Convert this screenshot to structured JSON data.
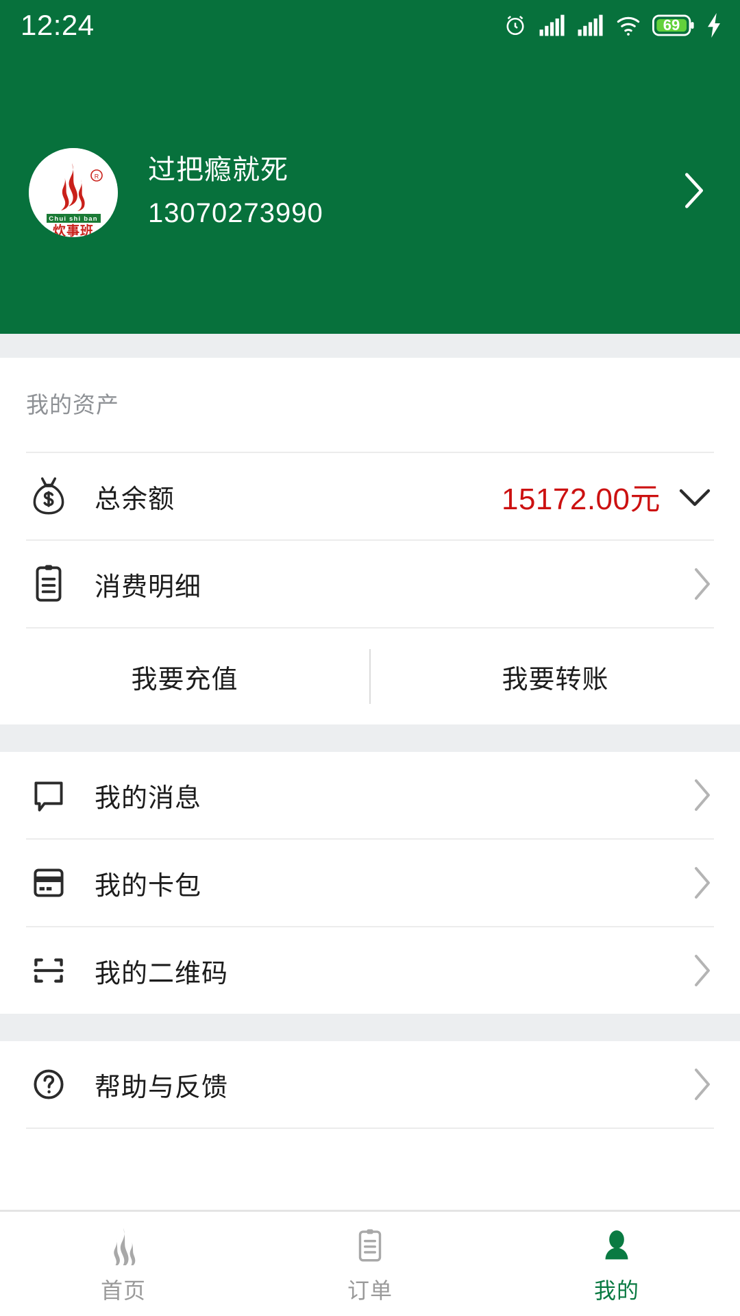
{
  "status_bar": {
    "time": "12:24",
    "battery_percent": "69",
    "icons": [
      "alarm-icon",
      "signal-sim1-icon",
      "signal-sim2-icon",
      "wifi-icon",
      "battery-icon",
      "charging-bolt-icon"
    ]
  },
  "theme": {
    "brand_green": "#07713C",
    "accent_red": "#CC1111",
    "page_bg": "#ECEEF0",
    "card_bg": "#FFFFFF",
    "muted_text": "#8E9195",
    "nav_active": "#0A7A42"
  },
  "profile": {
    "name": "过把瘾就死",
    "phone": "13070273990",
    "avatar_brand_latin": "Chui shi ban",
    "avatar_brand_cn": "炊事班",
    "avatar_trademark": "®",
    "chevron": "chevron-right-icon"
  },
  "assets": {
    "section_title": "我的资产",
    "balance": {
      "icon": "money-bag-icon",
      "label": "总余额",
      "value": "15172.00元",
      "tail_icon": "chevron-down-icon"
    },
    "detail": {
      "icon": "clipboard-list-icon",
      "label": "消费明细",
      "tail_icon": "chevron-right-icon"
    },
    "actions": [
      {
        "label": "我要充值"
      },
      {
        "label": "我要转账"
      }
    ]
  },
  "menu_primary": [
    {
      "icon": "speech-bubble-icon",
      "label": "我的消息",
      "tail_icon": "chevron-right-icon"
    },
    {
      "icon": "credit-card-icon",
      "label": "我的卡包",
      "tail_icon": "chevron-right-icon"
    },
    {
      "icon": "qr-scan-icon",
      "label": "我的二维码",
      "tail_icon": "chevron-right-icon"
    }
  ],
  "menu_secondary": [
    {
      "icon": "question-circle-icon",
      "label": "帮助与反馈",
      "tail_icon": "chevron-right-icon"
    }
  ],
  "bottom_nav": [
    {
      "icon": "flame-icon",
      "label": "首页",
      "active": false
    },
    {
      "icon": "clipboard-icon",
      "label": "订单",
      "active": false
    },
    {
      "icon": "person-icon",
      "label": "我的",
      "active": true
    }
  ]
}
